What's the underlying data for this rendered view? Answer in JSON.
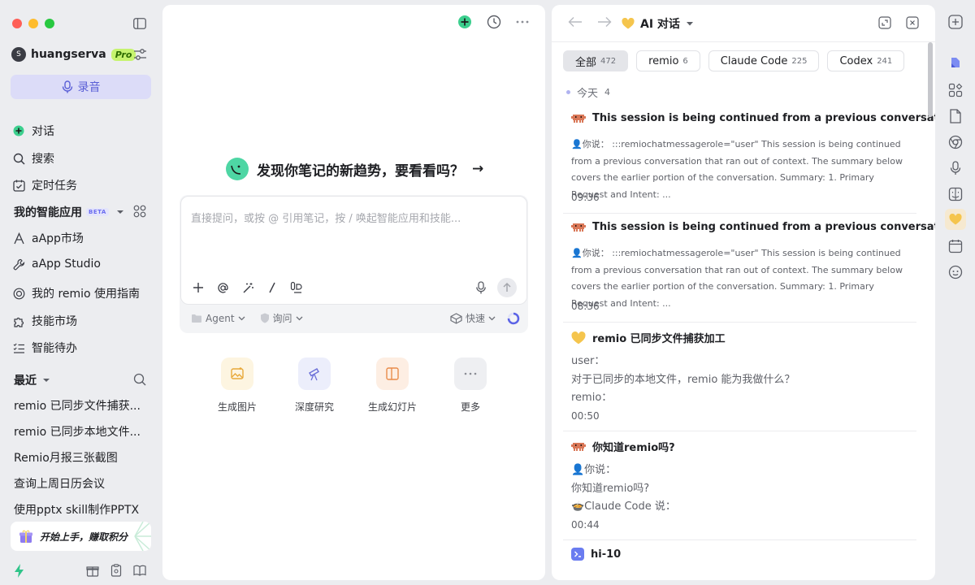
{
  "sidebar": {
    "username": "huangserva",
    "avatar_letter": "S",
    "plan_badge": "Pro",
    "record_label": "录音",
    "nav": [
      {
        "label": "对话",
        "icon": "chat-plus-icon"
      },
      {
        "label": "搜索",
        "icon": "search-icon"
      },
      {
        "label": "定时任务",
        "icon": "calendar-check-icon"
      }
    ],
    "apps_section": {
      "title": "我的智能应用",
      "badge": "BETA"
    },
    "apps": [
      {
        "label": "aApp市场",
        "icon": "a-app-icon"
      },
      {
        "label": "aApp Studio",
        "icon": "wrench-icon"
      },
      {
        "label": "我的 remio 使用指南",
        "icon": "guide-icon"
      },
      {
        "label": "技能市场",
        "icon": "puzzle-icon"
      },
      {
        "label": "智能待办",
        "icon": "todo-list-icon"
      }
    ],
    "recent_section": {
      "title": "最近"
    },
    "recent": [
      "remio 已同步文件捕获...",
      "remio 已同步本地文件...",
      "Remio月报三张截图",
      "查询上周日历会议",
      "使用pptx skill制作PPTX"
    ],
    "promo_label": "开始上手，赚取积分"
  },
  "center": {
    "hero_text": "发现你笔记的新趋势，要看看吗？",
    "hero_arrow": "→",
    "composer_placeholder": "直接提问，或按 @ 引用笔记，按 / 唤起智能应用和技能...",
    "options": {
      "agent": "Agent",
      "mode": "询问",
      "speed": "快速"
    },
    "quick_actions": [
      {
        "label": "生成图片",
        "icon": "image-sparkle-icon",
        "bg": "#fdf5e1",
        "color": "#e8a93a"
      },
      {
        "label": "深度研究",
        "icon": "telescope-icon",
        "bg": "#eceefb",
        "color": "#6b6fd8"
      },
      {
        "label": "生成幻灯片",
        "icon": "slides-icon",
        "bg": "#fdeee3",
        "color": "#e98c4a"
      },
      {
        "label": "更多",
        "icon": "more-icon",
        "bg": "#eeeff2",
        "color": "#8a8d94"
      }
    ]
  },
  "right_panel": {
    "title": "AI 对话",
    "filters": [
      {
        "label": "全部",
        "count": "472",
        "active": true
      },
      {
        "label": "remio",
        "count": "6",
        "active": false
      },
      {
        "label": "Claude Code",
        "count": "225",
        "active": false
      },
      {
        "label": "Codex",
        "count": "241",
        "active": false
      }
    ],
    "day_label": "今天",
    "day_count": "4",
    "conversations": [
      {
        "title": "This session is being continued from a previous conversatio...",
        "text": "👤你说： :::remiochatmessagerole=\"user\" This session is being continued from a previous conversation that ran out of context. The summary below covers the earlier portion of the conversation. Summary: 1. Primary Request and Intent: ...",
        "time": "09:36",
        "icon": "claude-code-icon"
      },
      {
        "title": "This session is being continued from a previous conversatio...",
        "text": "👤你说： :::remiochatmessagerole=\"user\" This session is being continued from a previous conversation that ran out of context. The summary below covers the earlier portion of the conversation. Summary: 1. Primary Request and Intent: ...",
        "time": "08:36",
        "icon": "claude-code-icon"
      },
      {
        "title": "remio 已同步文件捕获加工",
        "lines": [
          "user：",
          "对于已同步的本地文件，remio 能为我做什么？",
          "remio："
        ],
        "time": "00:50",
        "icon": "remio-heart-icon"
      },
      {
        "title": "你知道remio吗?",
        "lines": [
          "👤你说：",
          "你知道remio吗?",
          "🍲Claude Code 说："
        ],
        "time": "00:44",
        "icon": "claude-code-icon"
      },
      {
        "title": "hi-10",
        "icon": "codex-icon"
      }
    ]
  }
}
